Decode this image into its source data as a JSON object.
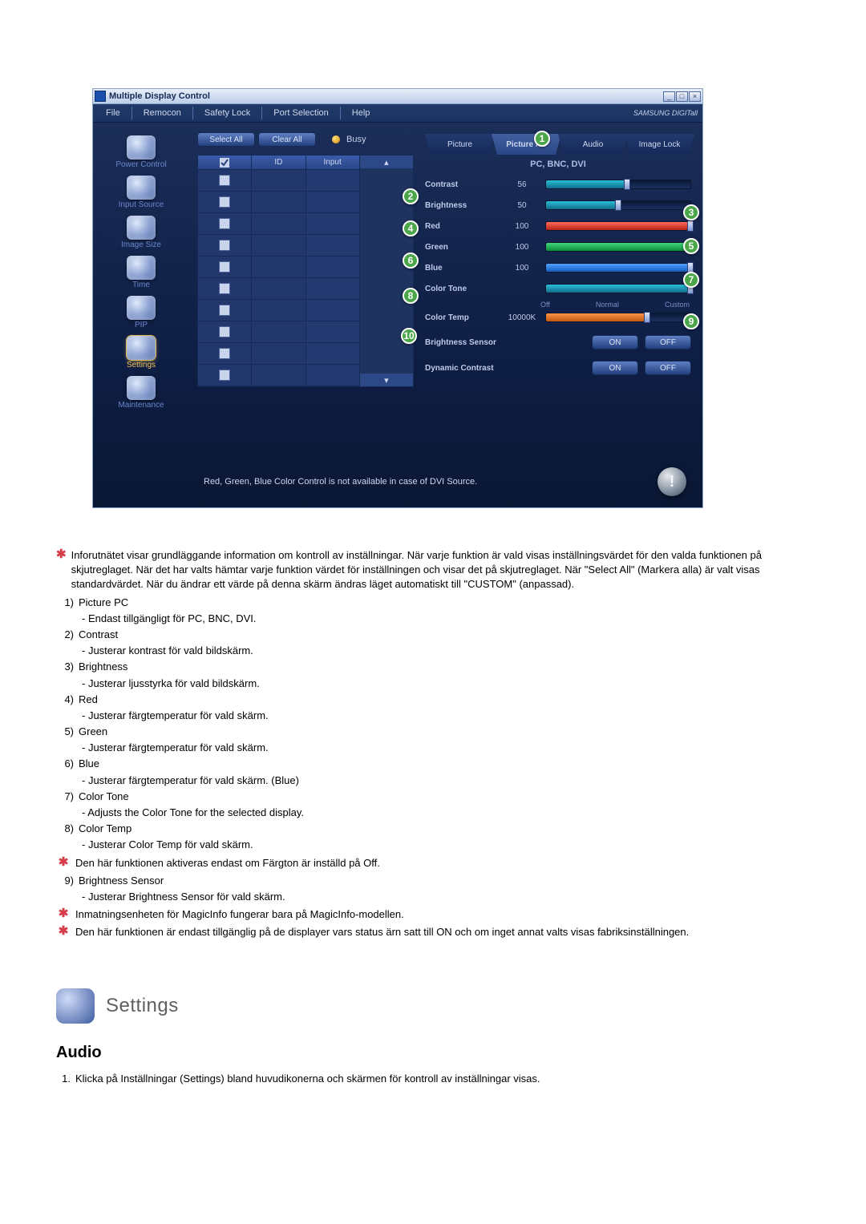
{
  "window": {
    "title": "Multiple Display Control",
    "menubar": [
      "File",
      "Remocon",
      "Safety Lock",
      "Port Selection",
      "Help"
    ],
    "brand": "SAMSUNG DIGITall"
  },
  "sidebar": [
    {
      "label": "Power Control",
      "hl": false
    },
    {
      "label": "Input Source",
      "hl": false
    },
    {
      "label": "Image Size",
      "hl": false
    },
    {
      "label": "Time",
      "hl": false
    },
    {
      "label": "PIP",
      "hl": false
    },
    {
      "label": "Settings",
      "hl": true
    },
    {
      "label": "Maintenance",
      "hl": false
    }
  ],
  "centerbuttons": {
    "select_all": "Select All",
    "clear_all": "Clear All",
    "busy": "Busy"
  },
  "grid_headers": {
    "id": "ID",
    "input": "Input"
  },
  "tabs": [
    "Picture",
    "Picture PC",
    "Audio",
    "Image Lock"
  ],
  "subtitle": "PC, BNC, DVI",
  "sliders": {
    "contrast": {
      "label": "Contrast",
      "value": "56",
      "pct": 56
    },
    "brightness": {
      "label": "Brightness",
      "value": "50",
      "pct": 50
    },
    "red": {
      "label": "Red",
      "value": "100",
      "pct": 100,
      "cls": "red"
    },
    "green": {
      "label": "Green",
      "value": "100",
      "pct": 100,
      "cls": "green"
    },
    "blue": {
      "label": "Blue",
      "value": "100",
      "pct": 100,
      "cls": "blue"
    },
    "tone": {
      "label": "Color Tone",
      "value": "",
      "pct": 100,
      "ticks": [
        "Off",
        "Normal",
        "Custom"
      ]
    },
    "temp": {
      "label": "Color Temp",
      "value": "10000K",
      "pct": 70,
      "cls": "amber"
    }
  },
  "toggles": {
    "bs": {
      "label": "Brightness Sensor",
      "on": "ON",
      "off": "OFF"
    },
    "dc": {
      "label": "Dynamic Contrast",
      "on": "ON",
      "off": "OFF"
    }
  },
  "footer_msg": "Red, Green, Blue Color Control is not available in case of DVI Source.",
  "intro_star": "Inforutnätet visar grundläggande information om kontroll av inställningar. När varje funktion är vald visas inställningsvärdet för den valda funktionen på skjutreglaget. När det har valts hämtar varje funktion värdet för inställningen och visar det på skjutreglaget. När \"Select All\" (Markera alla) är valt visas standardvärdet. När du ändrar ett värde på denna skärm ändras läget automatiskt till \"CUSTOM\" (anpassad).",
  "items": [
    {
      "n": "1)",
      "t": "Picture PC",
      "d": "- Endast tillgängligt för PC, BNC, DVI."
    },
    {
      "n": "2)",
      "t": "Contrast",
      "d": "- Justerar kontrast för vald bildskärm."
    },
    {
      "n": "3)",
      "t": "Brightness",
      "d": "- Justerar ljusstyrka för vald bildskärm."
    },
    {
      "n": "4)",
      "t": "Red",
      "d": "- Justerar färgtemperatur för vald skärm."
    },
    {
      "n": "5)",
      "t": "Green",
      "d": "- Justerar färgtemperatur för vald skärm."
    },
    {
      "n": "6)",
      "t": "Blue",
      "d": "- Justerar färgtemperatur för vald skärm. (Blue)"
    },
    {
      "n": "7)",
      "t": "Color Tone",
      "d": "- Adjusts the Color Tone for the selected display."
    },
    {
      "n": "8)",
      "t": "Color Temp",
      "d": "- Justerar Color Temp för vald skärm."
    }
  ],
  "star_after_8": "Den här funktionen aktiveras endast om Färgton är inställd på Off.",
  "item9": {
    "n": "9)",
    "t": "Brightness Sensor",
    "d": "- Justerar Brightness Sensor för vald skärm."
  },
  "star_magic": "Inmatningsenheten för MagicInfo fungerar bara på MagicInfo-modellen.",
  "star_only": "Den här funktionen är endast tillgänglig på de displayer vars status ärn satt till ON och om inget annat valts visas fabriksinställningen.",
  "section": {
    "title": "Settings"
  },
  "sub": {
    "heading": "Audio"
  },
  "steps": [
    {
      "n": "1.",
      "t": "Klicka på Inställningar (Settings) bland huvudikonerna och skärmen för kontroll av inställningar visas."
    }
  ]
}
